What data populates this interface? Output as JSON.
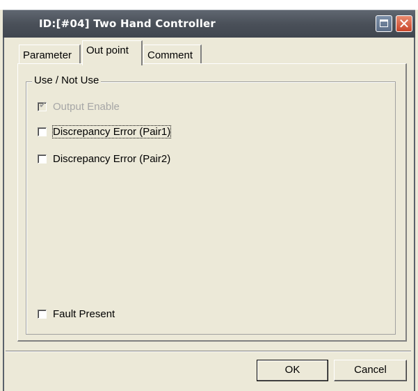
{
  "window": {
    "title": "ID:[#04]  Two Hand Controller"
  },
  "tabs": [
    {
      "label": "Parameter",
      "active": false
    },
    {
      "label": "Out point",
      "active": true
    },
    {
      "label": "Comment",
      "active": false
    }
  ],
  "group": {
    "title": "Use / Not Use"
  },
  "checkboxes": {
    "output_enable": {
      "label": "Output Enable",
      "checked": true,
      "enabled": false
    },
    "pair1": {
      "label": "Discrepancy Error (Pair1)",
      "checked": false,
      "enabled": true
    },
    "pair2": {
      "label": "Discrepancy Error (Pair2)",
      "checked": false,
      "enabled": true
    },
    "fault": {
      "label": "Fault Present",
      "checked": false,
      "enabled": true
    }
  },
  "buttons": {
    "ok": "OK",
    "cancel": "Cancel"
  },
  "colors": {
    "face": "#ece9d8",
    "titlebar": "#4a5059",
    "close": "#c9452a"
  }
}
